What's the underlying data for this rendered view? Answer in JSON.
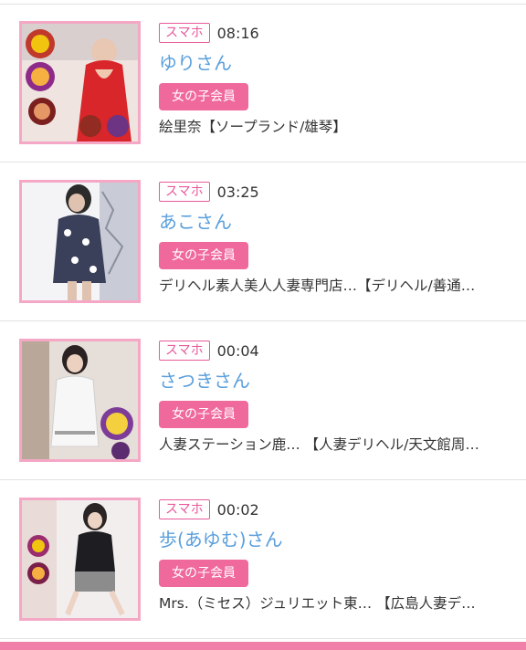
{
  "device_label": "スマホ",
  "member_label": "女の子会員",
  "colors": {
    "accent_pink": "#e75a9b",
    "badge_fill": "#f0699d",
    "name_blue": "#5a9fdc",
    "thumb_border": "#f4a8c5"
  },
  "posts": [
    {
      "time": "08:16",
      "name": "ゆりさん",
      "shop": "絵里奈【ソープランド/雄琴】",
      "thumb_icon": "profile-photo-red-dress"
    },
    {
      "time": "03:25",
      "name": "あこさん",
      "shop": "デリヘル素人美人人妻専門店…【デリヘル/善通…",
      "thumb_icon": "profile-photo-floral-dress"
    },
    {
      "time": "00:04",
      "name": "さつきさん",
      "shop": "人妻ステーション鹿… 【人妻デリヘル/天文館周…",
      "thumb_icon": "profile-photo-white-dress"
    },
    {
      "time": "00:02",
      "name": "歩(あゆむ)さん",
      "shop": "Mrs.（ミセス）ジュリエット東… 【広島人妻デ…",
      "thumb_icon": "profile-photo-black-outfit"
    }
  ]
}
